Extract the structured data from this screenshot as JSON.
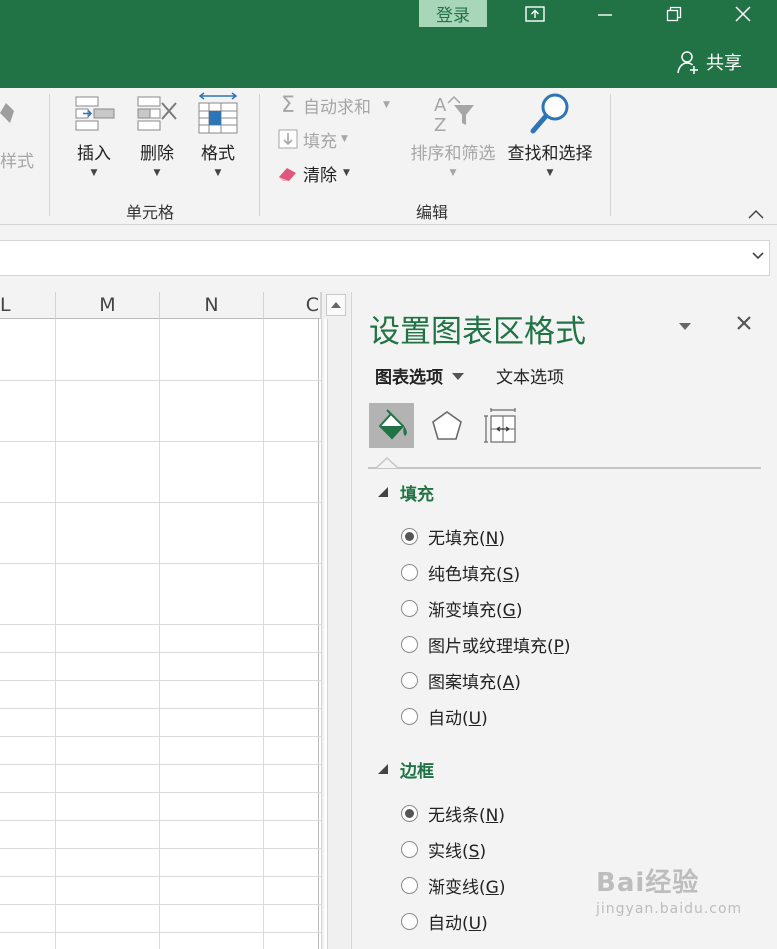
{
  "titlebar": {
    "login_label": "登录",
    "share_label": "共享"
  },
  "ribbon": {
    "styles_partial_label": "样式",
    "cells_group": {
      "label": "单元格",
      "insert_label": "插入",
      "delete_label": "删除",
      "format_label": "格式"
    },
    "editing_group": {
      "label": "编辑",
      "autosum_label": "自动求和",
      "fill_label": "填充",
      "clear_label": "清除",
      "sort_filter_label": "排序和筛选",
      "find_select_label": "查找和选择"
    }
  },
  "sheet": {
    "columns": [
      "L",
      "M",
      "N",
      "C"
    ]
  },
  "format_pane": {
    "title": "设置图表区格式",
    "tab_chart_options": "图表选项",
    "tab_text_options": "文本选项",
    "icon_tabs": [
      "fill-line-icon",
      "effects-pentagon-icon",
      "size-properties-icon"
    ],
    "fill_section": {
      "label": "填充",
      "options": [
        {
          "label": "无填充",
          "key": "N",
          "selected": true
        },
        {
          "label": "纯色填充",
          "key": "S",
          "selected": false
        },
        {
          "label": "渐变填充",
          "key": "G",
          "selected": false
        },
        {
          "label": "图片或纹理填充",
          "key": "P",
          "selected": false
        },
        {
          "label": "图案填充",
          "key": "A",
          "selected": false
        },
        {
          "label": "自动",
          "key": "U",
          "selected": false
        }
      ]
    },
    "border_section": {
      "label": "边框",
      "options": [
        {
          "label": "无线条",
          "key": "N",
          "selected": true
        },
        {
          "label": "实线",
          "key": "S",
          "selected": false
        },
        {
          "label": "渐变线",
          "key": "G",
          "selected": false
        },
        {
          "label": "自动",
          "key": "U",
          "selected": false
        }
      ]
    }
  },
  "watermark": {
    "brand": "Bai经验",
    "url": "jingyan.baidu.com"
  },
  "colors": {
    "accent": "#217346",
    "login_bg": "#a8d6b8"
  }
}
